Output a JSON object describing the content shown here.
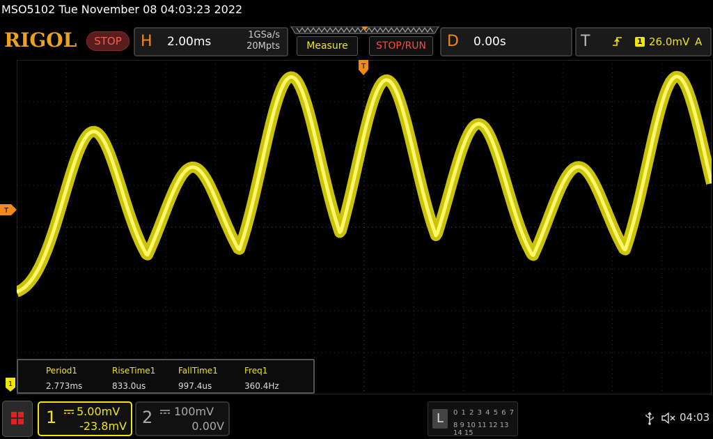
{
  "title": "MSO5102  Tue November 08 04:03:23 2022",
  "brand": "RIGOL",
  "status": "STOP",
  "horizontal": {
    "letter": "H",
    "timebase": "2.00ms",
    "sample_rate": "1GSa/s",
    "memory_depth": "20Mpts"
  },
  "buttons": {
    "measure": "Measure",
    "stop_run": "STOP/RUN"
  },
  "delay": {
    "letter": "D",
    "value": "0.00s"
  },
  "trigger": {
    "letter": "T",
    "edge_icon": "rising-edge-icon",
    "channel": "1",
    "level": "26.0mV",
    "mode": "A"
  },
  "markers": {
    "trigger_position": "T",
    "trigger_level": "T",
    "channel1": "1"
  },
  "measurements": [
    {
      "name": "Period1",
      "value": "2.773ms"
    },
    {
      "name": "RiseTime1",
      "value": "833.0us"
    },
    {
      "name": "FallTime1",
      "value": "997.4us"
    },
    {
      "name": "Freq1",
      "value": "360.4Hz"
    }
  ],
  "channel1": {
    "number": "1",
    "coupling_icon": "dc-coupling-icon",
    "scale": "5.00mV",
    "offset": "-23.8mV",
    "color": "#f0e60a"
  },
  "channel2": {
    "number": "2",
    "coupling_icon": "dc-coupling-icon",
    "scale": "100mV",
    "offset": "0.00V"
  },
  "logic_analyzer": {
    "letter": "L",
    "row1": "0 1 2 3  4 5 6 7",
    "row2": "8 9 10 11 12 13 14 15"
  },
  "clock": "04:03",
  "colors": {
    "accent": "#e9a31e",
    "trace": "#f0e60a",
    "stop": "#ff4a3a"
  }
}
